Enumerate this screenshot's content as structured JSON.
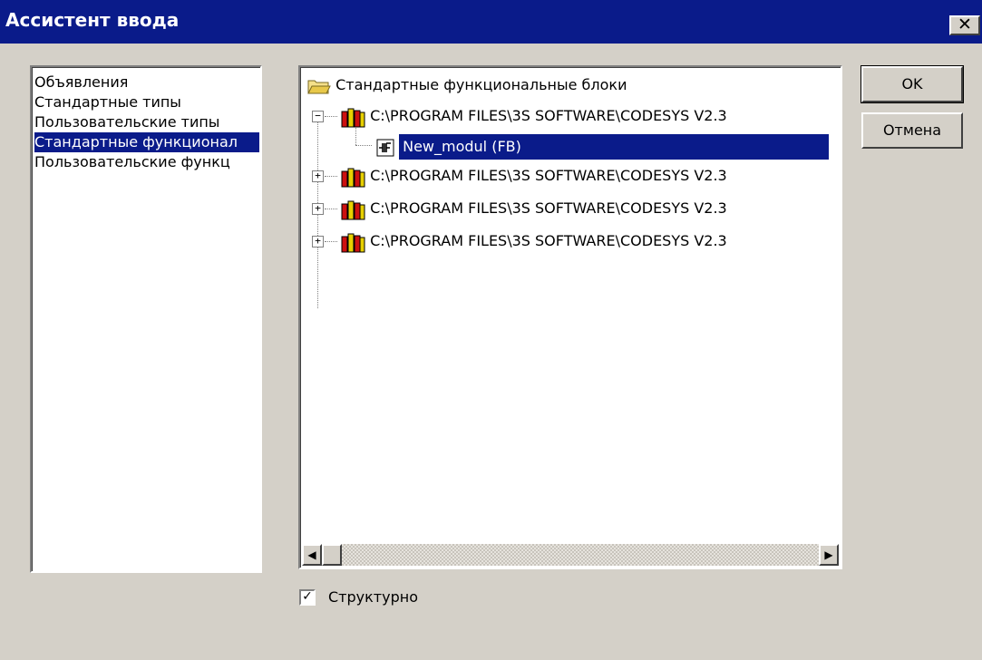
{
  "window": {
    "title": "Ассистент ввода",
    "close_label": "✕"
  },
  "categories": [
    {
      "label": "Объявления",
      "selected": false
    },
    {
      "label": "Стандартные типы",
      "selected": false
    },
    {
      "label": "Пользовательские типы",
      "selected": false
    },
    {
      "label": "Стандартные функционал",
      "selected": true
    },
    {
      "label": "Пользовательские функц",
      "selected": false
    }
  ],
  "tree": {
    "root_label": "Стандартные функциональные блоки",
    "nodes": [
      {
        "label": "C:\\PROGRAM FILES\\3S SOFTWARE\\CODESYS V2.3",
        "expander": "−"
      },
      {
        "label": "New_modul (FB)",
        "selected": true
      },
      {
        "label": "C:\\PROGRAM FILES\\3S SOFTWARE\\CODESYS V2.3",
        "expander": "+"
      },
      {
        "label": "C:\\PROGRAM FILES\\3S SOFTWARE\\CODESYS V2.3",
        "expander": "+"
      },
      {
        "label": "C:\\PROGRAM FILES\\3S SOFTWARE\\CODESYS V2.3",
        "expander": "+"
      }
    ]
  },
  "buttons": {
    "ok": "OK",
    "cancel": "Отмена"
  },
  "structured": {
    "label": "Структурно",
    "checked": true
  },
  "scrollbar": {
    "left_arrow": "◀",
    "right_arrow": "▶"
  },
  "colors": {
    "titlebar": "#0a1b8a",
    "selection": "#0a1b8a",
    "face": "#d4d0c8"
  }
}
